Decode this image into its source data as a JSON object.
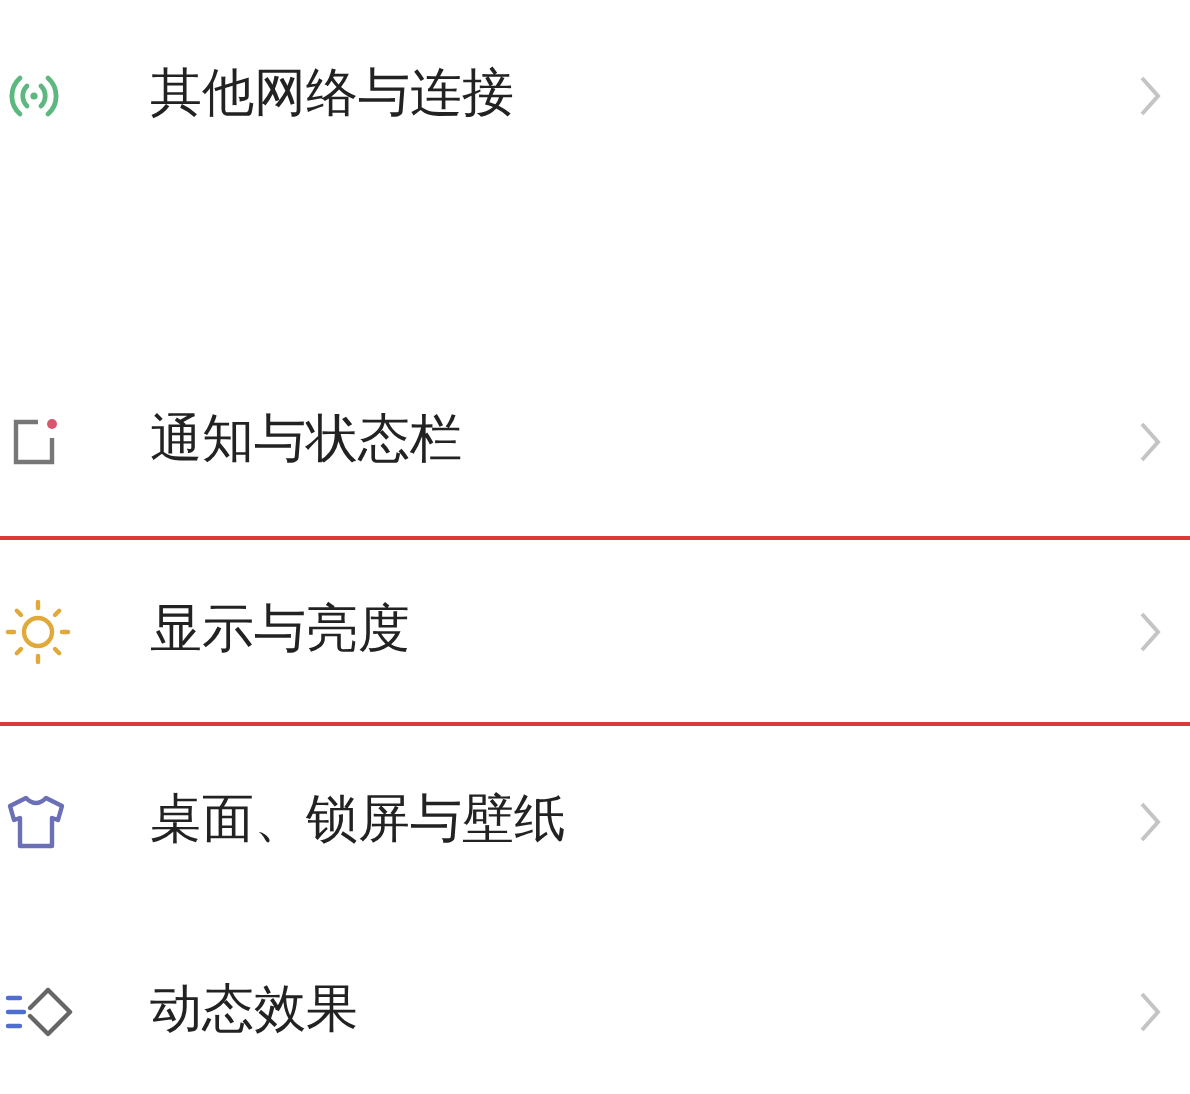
{
  "sections": [
    {
      "items": [
        {
          "label": "其他网络与连接",
          "highlighted": false
        }
      ]
    },
    {
      "items": [
        {
          "label": "通知与状态栏",
          "highlighted": false
        },
        {
          "label": "显示与亮度",
          "highlighted": true
        },
        {
          "label": "桌面、锁屏与壁纸",
          "highlighted": false
        },
        {
          "label": "动态效果",
          "highlighted": false
        }
      ]
    }
  ]
}
